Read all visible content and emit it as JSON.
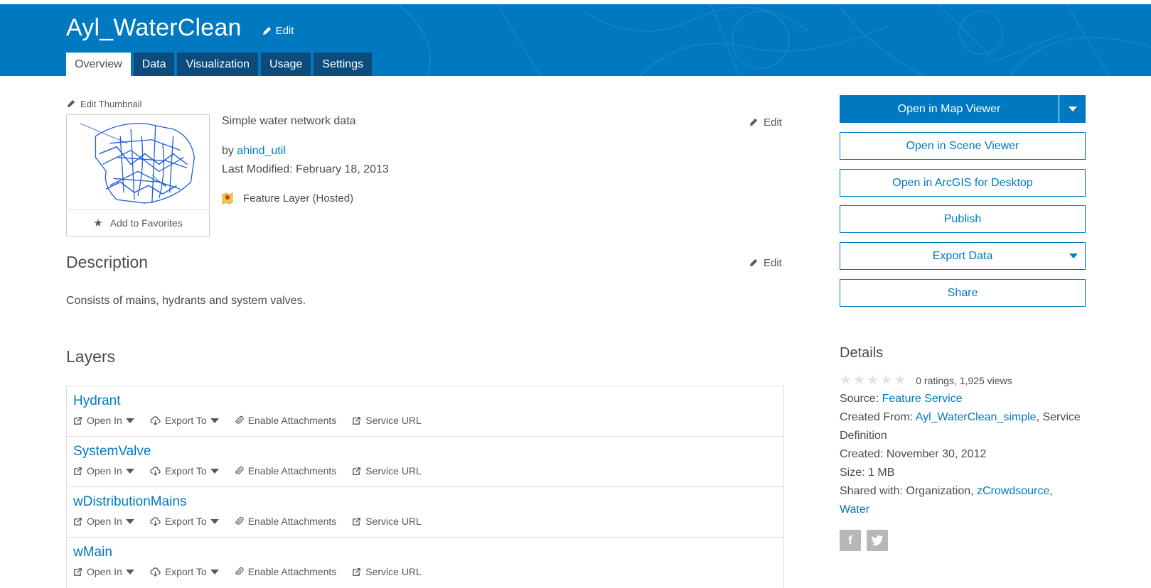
{
  "header": {
    "title": "Ayl_WaterClean",
    "edit_label": "Edit",
    "tabs": [
      {
        "label": "Overview",
        "active": true
      },
      {
        "label": "Data",
        "active": false
      },
      {
        "label": "Visualization",
        "active": false
      },
      {
        "label": "Usage",
        "active": false
      },
      {
        "label": "Settings",
        "active": false
      }
    ]
  },
  "thumbnail": {
    "edit_label": "Edit Thumbnail",
    "favorites_label": "Add to Favorites"
  },
  "summary": {
    "text": "Simple water network data",
    "edit_label": "Edit",
    "by_prefix": "by",
    "owner": "ahind_util",
    "last_modified": "Last Modified: February 18, 2013",
    "item_type": "Feature Layer (Hosted)"
  },
  "description": {
    "heading": "Description",
    "edit_label": "Edit",
    "text": "Consists of mains, hydrants and system valves."
  },
  "layers": {
    "heading": "Layers",
    "actions": {
      "open_in": "Open In",
      "export_to": "Export To",
      "enable_attachments": "Enable Attachments",
      "service_url": "Service URL"
    },
    "items": [
      {
        "name": "Hydrant"
      },
      {
        "name": "SystemValve"
      },
      {
        "name": "wDistributionMains"
      },
      {
        "name": "wMain"
      }
    ]
  },
  "actions": {
    "open_map_viewer": "Open in Map Viewer",
    "open_scene_viewer": "Open in Scene Viewer",
    "open_arcgis_desktop": "Open in ArcGIS for Desktop",
    "publish": "Publish",
    "export_data": "Export Data",
    "share": "Share"
  },
  "details": {
    "heading": "Details",
    "ratings_text": "0 ratings, 1,925 views",
    "source_label": "Source:",
    "source_value": "Feature Service",
    "created_from_label": "Created From:",
    "created_from_value": "Ayl_WaterClean_simple",
    "created_from_suffix": ", Service",
    "created_from_suffix2": "Definition",
    "created": "Created: November 30, 2012",
    "size": "Size: 1 MB",
    "shared_label": "Shared with:",
    "shared_org": "Organization",
    "shared_group1": "zCrowdsource",
    "shared_group2": "Water"
  },
  "colors": {
    "brand": "#0079c1",
    "tab_dark": "#0b4c7c",
    "text": "#4c4c4c"
  }
}
